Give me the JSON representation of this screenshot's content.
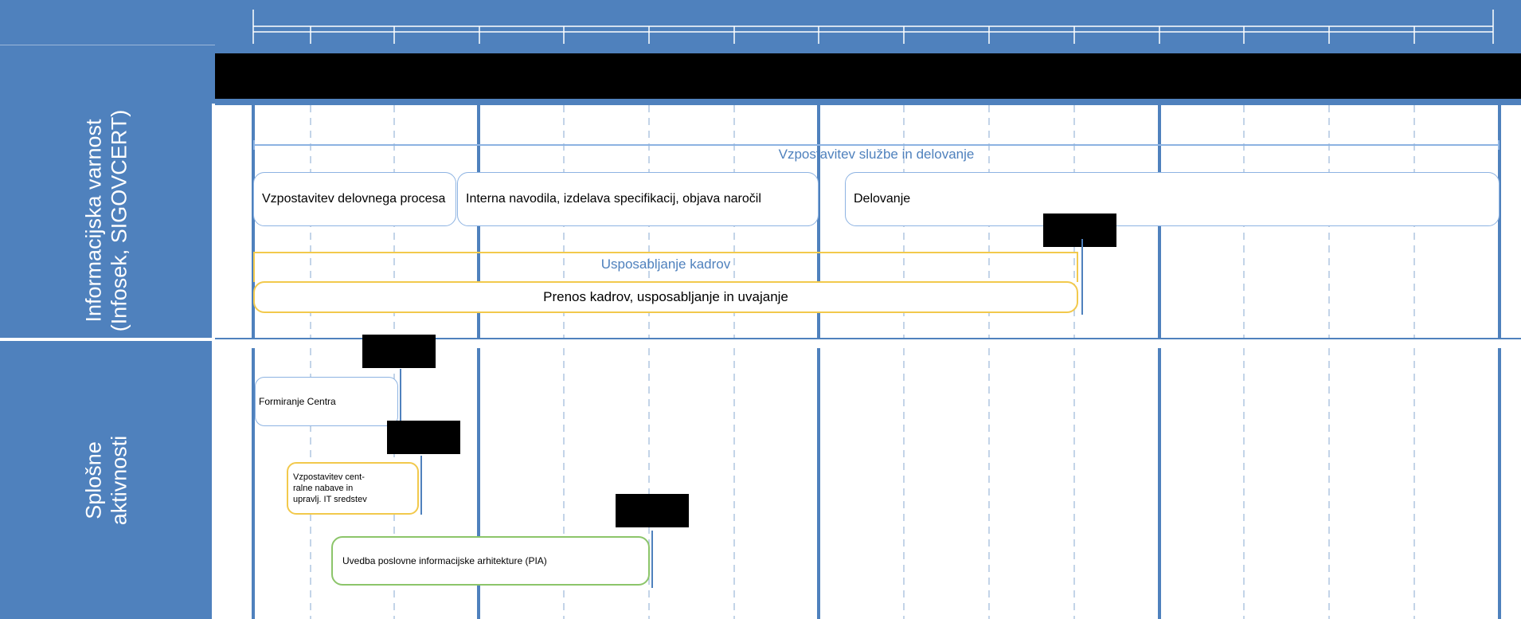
{
  "colors": {
    "header_blue": "#4f81bd",
    "line_blue": "#4f81bd",
    "box_blue_border": "#8db3e2",
    "box_yellow_border": "#f2c94c",
    "box_green_border": "#8cc56a",
    "redaction": "#000000"
  },
  "header": {
    "title": "",
    "redacted": true
  },
  "lanes": [
    {
      "label_line1": "Informacijska varnost",
      "label_line2": "(Infosek, SIGOVCERT)",
      "items": {
        "service_bar": "Vzpostavitev službe in delovanje",
        "box_process": "Vzpostavitev delovnega procesa",
        "box_guidelines": "Interna navodila, izdelava specifikacij, objava naročil",
        "box_operation": "Delovanje",
        "training_bar": "Usposabljanje kadrov",
        "box_transfer": "Prenos kadrov, usposabljanje in uvajanje"
      }
    },
    {
      "label_line1": "Splošne",
      "label_line2": "aktivnosti",
      "items": {
        "box_centre": "Formiranje Centra",
        "box_procurement": "Vzpostavitev cent-ralne nabave in upravlj. IT sredstev",
        "box_pia": "Uvedba poslovne informacijske arhitekture (PIA)"
      }
    }
  ]
}
